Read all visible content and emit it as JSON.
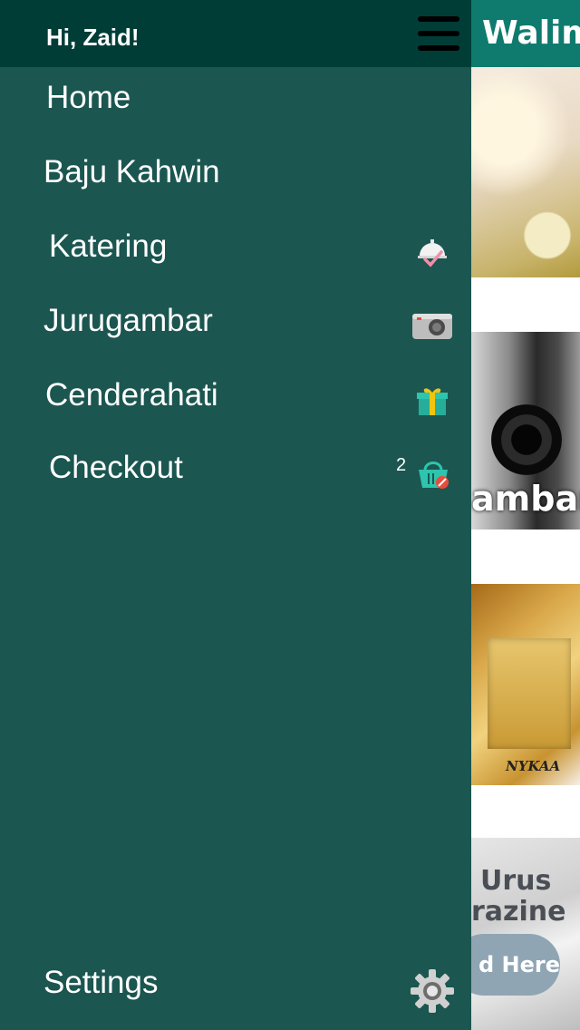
{
  "app": {
    "title": "Walim"
  },
  "background_cards": [
    {
      "id": "baju-kahwin-banner"
    },
    {
      "id": "jurugambar-banner",
      "caption": "ambar"
    },
    {
      "id": "cenderahati-banner",
      "brand": "NYKAA"
    },
    {
      "id": "magazine-banner",
      "line1": "Urus",
      "line2": "razine",
      "cta": "d Here"
    }
  ],
  "drawer": {
    "greeting": "Hi, Zaid!",
    "menu_icon": "hamburger-icon",
    "items": [
      {
        "label": "Home"
      },
      {
        "label": "Baju Kahwin"
      },
      {
        "label": "Katering",
        "icon": "cloche-icon"
      },
      {
        "label": "Jurugambar",
        "icon": "camera-icon"
      },
      {
        "label": "Cenderahati",
        "icon": "gift-icon"
      },
      {
        "label": "Checkout",
        "icon": "basket-icon",
        "badge": "2"
      }
    ],
    "settings": {
      "label": "Settings",
      "icon": "gear-icon"
    }
  },
  "colors": {
    "drawer_bg": "#1b5650",
    "drawer_header_bg": "#003d37",
    "app_bar_bg": "#0f7b6e",
    "text": "#ffffff"
  }
}
